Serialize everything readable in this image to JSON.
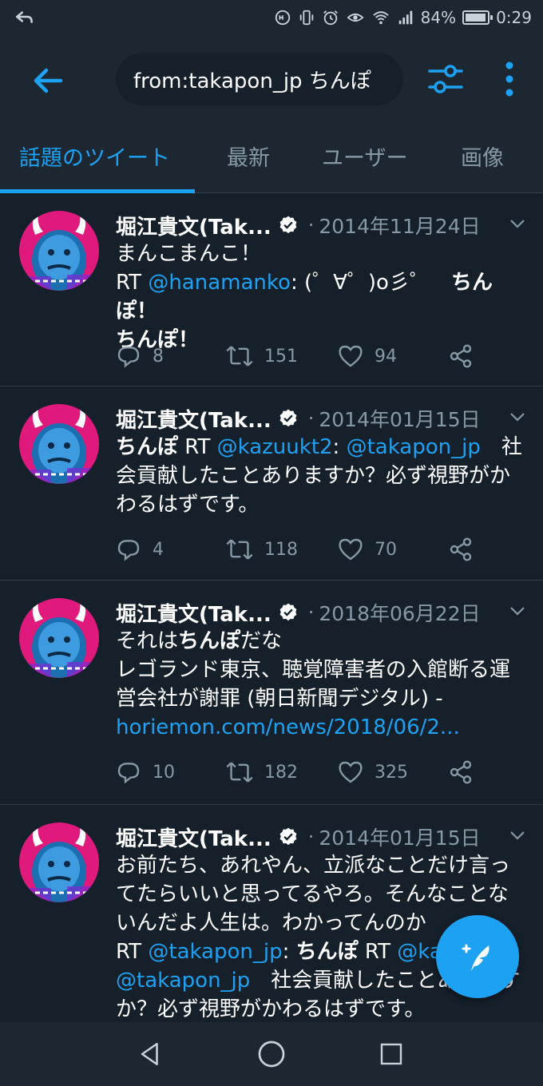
{
  "status_bar": {
    "battery": "84%",
    "time": "0:29"
  },
  "search": {
    "query": "from:takapon_jp ちんぽ"
  },
  "tabs": [
    {
      "label": "話題のツイート",
      "active": true
    },
    {
      "label": "最新",
      "active": false
    },
    {
      "label": "ユーザー",
      "active": false
    },
    {
      "label": "画像",
      "active": false
    }
  ],
  "tweets": [
    {
      "name": "堀江貴文(Tak...",
      "date": "2014年11月24日",
      "line1": "まんこまんこ！",
      "rt": "RT ",
      "mention1": "@hanamanko",
      "text_a": ": (゜∀゜)o彡゜",
      "bold_a": "ちんぽ！",
      "bold_b": "ちんぽ！",
      "replies": "8",
      "retweets": "151",
      "likes": "94"
    },
    {
      "name": "堀江貴文(Tak...",
      "date": "2014年01月15日",
      "bold_a": "ちんぽ",
      "rt": " RT ",
      "mention1": "@kazuukt2",
      "colon": ": ",
      "mention2": "@takapon_jp",
      "text_a": "　社会貢献したことありますか？必ず視野がかわるはずです。",
      "replies": "4",
      "retweets": "118",
      "likes": "70"
    },
    {
      "name": "堀江貴文(Tak...",
      "date": "2018年06月22日",
      "text_pre": "それは",
      "bold_a": "ちんぽ",
      "text_post": "だな",
      "line2": "レゴランド東京、聴覚障害者の入館断る運営会社が謝罪 (朝日新聞デジタル) -",
      "link": "horiemon.com/news/2018/06/2...",
      "replies": "10",
      "retweets": "182",
      "likes": "325"
    },
    {
      "name": "堀江貴文(Tak...",
      "date": "2014年01月15日",
      "line1": "お前たち、あれやん、立派なことだけ言ってたらいいと思ってるやろ。そんなことないんだよ人生は。わかってんのか",
      "rt": "RT ",
      "mention1": "@takapon_jp",
      "colon": ": ",
      "bold_a": "ちんぽ",
      "rt2": " RT ",
      "mention2": "@kazuukt2",
      "colon2": ": ",
      "mention3": "@takapon_jp",
      "text_a": "　社会貢献したことありますか？必ず視野がかわるはずです。"
    }
  ],
  "colors": {
    "background": "#15202b",
    "bar": "#1c2732",
    "accent": "#1da1f2",
    "muted": "#8899a6"
  }
}
